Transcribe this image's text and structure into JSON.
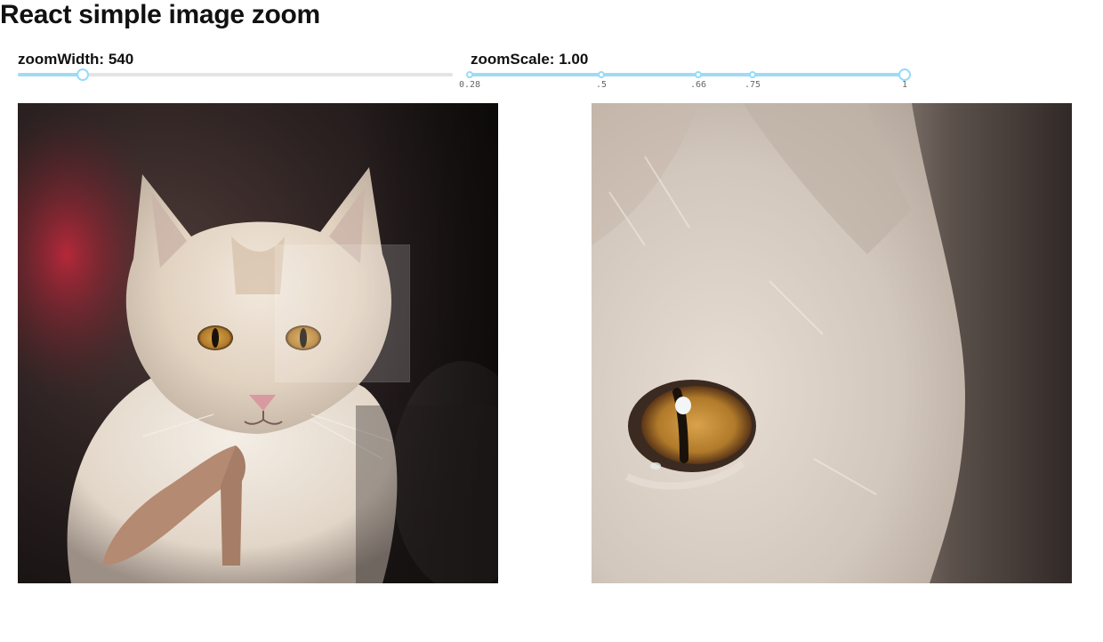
{
  "page_title": "React simple image zoom",
  "zoom_width": {
    "label": "zoomWidth: 540",
    "value": 540
  },
  "zoom_scale": {
    "label": "zoomScale: 1.00",
    "value": 1.0,
    "marks": [
      ".28",
      ".5",
      ".66",
      ".75",
      "1"
    ],
    "mark_labels": [
      "0.28",
      ".5",
      ".66",
      ".75",
      "1"
    ]
  },
  "images": {
    "source_alt": "cat",
    "zoom_alt": "cat zoomed"
  },
  "colors": {
    "accent": "#96dbfa",
    "track_fill": "#9edcf5",
    "rail": "#e4e4e4"
  }
}
